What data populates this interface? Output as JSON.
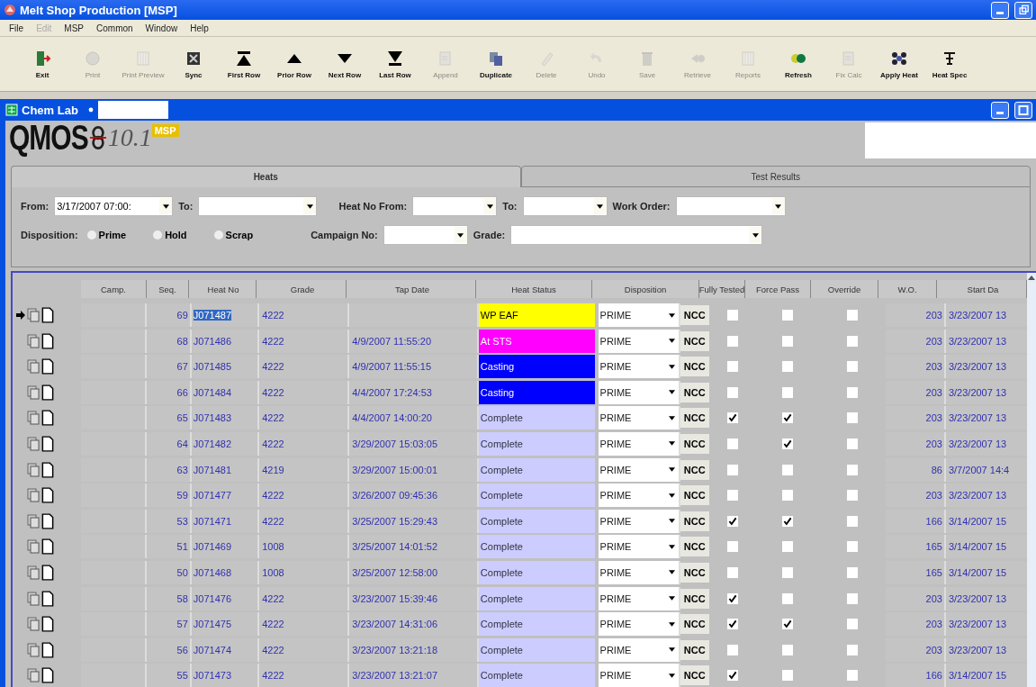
{
  "window": {
    "title": "Melt Shop Production [MSP]"
  },
  "menu": [
    {
      "label": "File",
      "disabled": false
    },
    {
      "label": "Edit",
      "disabled": true
    },
    {
      "label": "MSP",
      "disabled": false
    },
    {
      "label": "Common",
      "disabled": false
    },
    {
      "label": "Window",
      "disabled": false
    },
    {
      "label": "Help",
      "disabled": false
    }
  ],
  "toolbar": [
    {
      "label": "Exit",
      "kind": "exit",
      "disabled": false
    },
    {
      "label": "Print",
      "kind": "print",
      "disabled": true
    },
    {
      "label": "Print Preview",
      "kind": "preview",
      "disabled": true
    },
    {
      "label": "Sync",
      "kind": "sync",
      "disabled": false
    },
    {
      "label": "First Row",
      "kind": "first",
      "disabled": false
    },
    {
      "label": "Prior Row",
      "kind": "prior",
      "disabled": false
    },
    {
      "label": "Next Row",
      "kind": "next",
      "disabled": false
    },
    {
      "label": "Last Row",
      "kind": "last",
      "disabled": false
    },
    {
      "label": "Append",
      "kind": "append",
      "disabled": true
    },
    {
      "label": "Duplicate",
      "kind": "duplicate",
      "disabled": false
    },
    {
      "label": "Delete",
      "kind": "delete",
      "disabled": true
    },
    {
      "label": "Undo",
      "kind": "undo",
      "disabled": true
    },
    {
      "label": "Save",
      "kind": "save",
      "disabled": true
    },
    {
      "label": "Retrieve",
      "kind": "retrieve",
      "disabled": true
    },
    {
      "label": "Reports",
      "kind": "reports",
      "disabled": true
    },
    {
      "label": "Refresh",
      "kind": "refresh",
      "disabled": false
    },
    {
      "label": "Fix Calc",
      "kind": "append",
      "disabled": true
    },
    {
      "label": "Apply Heat",
      "kind": "apply",
      "disabled": false
    },
    {
      "label": "Heat Spec",
      "kind": "spec",
      "disabled": false
    }
  ],
  "child_window": {
    "title": "Chem Lab",
    "logo": {
      "name": "QMOS",
      "version": "10.1",
      "badge": "MSP"
    }
  },
  "tabs": [
    {
      "label": "Heats",
      "selected": true
    },
    {
      "label": "Test Results",
      "selected": false
    }
  ],
  "filters": {
    "from": "3/17/2007 07:00:",
    "to_label": "To:",
    "from_label": "From:",
    "heat_no_from_label": "Heat No From:",
    "heat_to_label": "To:",
    "work_order_label": "Work Order:",
    "disposition_label": "Disposition:",
    "campaign_label": "Campaign No:",
    "grade_label": "Grade:",
    "dispositions": [
      {
        "label": "Prime",
        "selected": false
      },
      {
        "label": "Hold",
        "selected": false
      },
      {
        "label": "Scrap",
        "selected": false
      }
    ]
  },
  "table": {
    "columns": [
      "Camp.",
      "Seq.",
      "Heat No",
      "Grade",
      "Tap Date",
      "Heat Status",
      "Disposition",
      "Fully Tested",
      "Force Pass",
      "Override",
      "W.O.",
      "Start Da"
    ],
    "rows": [
      {
        "current": true,
        "selected": true,
        "seq": "69",
        "heat_no": "J071487",
        "grade": "4222",
        "tap_date": "",
        "status": "WP EAF",
        "color": "#ffff00",
        "disposition": "PRIME",
        "ncc": "NCC",
        "fully_tested": false,
        "force_pass": false,
        "override": false,
        "wo": "203",
        "start": "3/23/2007 13"
      },
      {
        "current": false,
        "selected": false,
        "seq": "68",
        "heat_no": "J071486",
        "grade": "4222",
        "tap_date": "4/9/2007 11:55:20",
        "status": "At STS",
        "color": "#ff00ff",
        "disposition": "PRIME",
        "ncc": "NCC",
        "fully_tested": false,
        "force_pass": false,
        "override": false,
        "wo": "203",
        "start": "3/23/2007 13"
      },
      {
        "current": false,
        "selected": false,
        "seq": "67",
        "heat_no": "J071485",
        "grade": "4222",
        "tap_date": "4/9/2007 11:55:15",
        "status": "Casting",
        "color": "#0000ff",
        "disposition": "PRIME",
        "ncc": "NCC",
        "fully_tested": false,
        "force_pass": false,
        "override": false,
        "wo": "203",
        "start": "3/23/2007 13"
      },
      {
        "current": false,
        "selected": false,
        "seq": "66",
        "heat_no": "J071484",
        "grade": "4222",
        "tap_date": "4/4/2007 17:24:53",
        "status": "Casting",
        "color": "#0000ff",
        "disposition": "PRIME",
        "ncc": "NCC",
        "fully_tested": false,
        "force_pass": false,
        "override": false,
        "wo": "203",
        "start": "3/23/2007 13"
      },
      {
        "current": false,
        "selected": false,
        "seq": "65",
        "heat_no": "J071483",
        "grade": "4222",
        "tap_date": "4/4/2007 14:00:20",
        "status": "Complete",
        "color": "#ccccff",
        "disposition": "PRIME",
        "ncc": "NCC",
        "fully_tested": true,
        "force_pass": true,
        "override": false,
        "wo": "203",
        "start": "3/23/2007 13"
      },
      {
        "current": false,
        "selected": false,
        "seq": "64",
        "heat_no": "J071482",
        "grade": "4222",
        "tap_date": "3/29/2007 15:03:05",
        "status": "Complete",
        "color": "#ccccff",
        "disposition": "PRIME",
        "ncc": "NCC",
        "fully_tested": false,
        "force_pass": true,
        "override": false,
        "wo": "203",
        "start": "3/23/2007 13"
      },
      {
        "current": false,
        "selected": false,
        "seq": "63",
        "heat_no": "J071481",
        "grade": "4219",
        "tap_date": "3/29/2007 15:00:01",
        "status": "Complete",
        "color": "#ccccff",
        "disposition": "PRIME",
        "ncc": "NCC",
        "fully_tested": false,
        "force_pass": false,
        "override": false,
        "wo": "86",
        "start": "3/7/2007 14:4"
      },
      {
        "current": false,
        "selected": false,
        "seq": "59",
        "heat_no": "J071477",
        "grade": "4222",
        "tap_date": "3/26/2007 09:45:36",
        "status": "Complete",
        "color": "#ccccff",
        "disposition": "PRIME",
        "ncc": "NCC",
        "fully_tested": false,
        "force_pass": false,
        "override": false,
        "wo": "203",
        "start": "3/23/2007 13"
      },
      {
        "current": false,
        "selected": false,
        "seq": "53",
        "heat_no": "J071471",
        "grade": "4222",
        "tap_date": "3/25/2007 15:29:43",
        "status": "Complete",
        "color": "#ccccff",
        "disposition": "PRIME",
        "ncc": "NCC",
        "fully_tested": true,
        "force_pass": true,
        "override": false,
        "wo": "166",
        "start": "3/14/2007 15"
      },
      {
        "current": false,
        "selected": false,
        "seq": "51",
        "heat_no": "J071469",
        "grade": "1008",
        "tap_date": "3/25/2007 14:01:52",
        "status": "Complete",
        "color": "#ccccff",
        "disposition": "PRIME",
        "ncc": "NCC",
        "fully_tested": false,
        "force_pass": false,
        "override": false,
        "wo": "165",
        "start": "3/14/2007 15"
      },
      {
        "current": false,
        "selected": false,
        "seq": "50",
        "heat_no": "J071468",
        "grade": "1008",
        "tap_date": "3/25/2007 12:58:00",
        "status": "Complete",
        "color": "#ccccff",
        "disposition": "PRIME",
        "ncc": "NCC",
        "fully_tested": false,
        "force_pass": false,
        "override": false,
        "wo": "165",
        "start": "3/14/2007 15"
      },
      {
        "current": false,
        "selected": false,
        "seq": "58",
        "heat_no": "J071476",
        "grade": "4222",
        "tap_date": "3/23/2007 15:39:46",
        "status": "Complete",
        "color": "#ccccff",
        "disposition": "PRIME",
        "ncc": "NCC",
        "fully_tested": true,
        "force_pass": false,
        "override": false,
        "wo": "203",
        "start": "3/23/2007 13"
      },
      {
        "current": false,
        "selected": false,
        "seq": "57",
        "heat_no": "J071475",
        "grade": "4222",
        "tap_date": "3/23/2007 14:31:06",
        "status": "Complete",
        "color": "#ccccff",
        "disposition": "PRIME",
        "ncc": "NCC",
        "fully_tested": true,
        "force_pass": true,
        "override": false,
        "wo": "203",
        "start": "3/23/2007 13"
      },
      {
        "current": false,
        "selected": false,
        "seq": "56",
        "heat_no": "J071474",
        "grade": "4222",
        "tap_date": "3/23/2007 13:21:18",
        "status": "Complete",
        "color": "#ccccff",
        "disposition": "PRIME",
        "ncc": "NCC",
        "fully_tested": false,
        "force_pass": false,
        "override": false,
        "wo": "203",
        "start": "3/23/2007 13"
      },
      {
        "current": false,
        "selected": false,
        "seq": "55",
        "heat_no": "J071473",
        "grade": "4222",
        "tap_date": "3/23/2007 13:21:07",
        "status": "Complete",
        "color": "#ccccff",
        "disposition": "PRIME",
        "ncc": "NCC",
        "fully_tested": true,
        "force_pass": false,
        "override": false,
        "wo": "166",
        "start": "3/14/2007 15"
      }
    ]
  }
}
